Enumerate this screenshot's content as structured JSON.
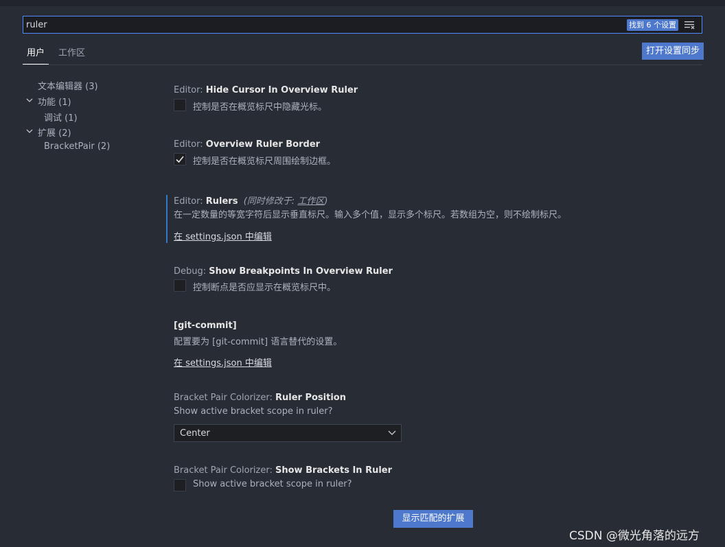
{
  "search": {
    "value": "ruler",
    "result_badge": "找到 6 个设置",
    "clear_icon": "clear-filter-icon"
  },
  "tabs": [
    {
      "label": "用户",
      "active": true
    },
    {
      "label": "工作区",
      "active": false
    }
  ],
  "sync_button": "打开设置同步",
  "toc": [
    {
      "label": "文本编辑器 (3)"
    },
    {
      "label": "功能 (1)",
      "expanded": true
    },
    {
      "label": "调试 (1)"
    },
    {
      "label": "扩展 (2)",
      "expanded": true
    },
    {
      "label": "BracketPair (2)"
    }
  ],
  "settings": [
    {
      "category": "Editor: ",
      "name": "Hide Cursor In Overview Ruler",
      "description": "控制是否在概览标尺中隐藏光标。",
      "checked": false
    },
    {
      "category": "Editor: ",
      "name": "Overview Ruler Border",
      "description": "控制是否在概览标尺周围绘制边框。",
      "checked": true
    },
    {
      "category": "Editor: ",
      "name": "Rulers",
      "note_prefix": "(同时修改于: ",
      "note_link": "工作区",
      "note_suffix": ")",
      "description": "在一定数量的等宽字符后显示垂直标尺。输入多个值，显示多个标尺。若数组为空，则不绘制标尺。",
      "edit_link": "在 settings.json 中编辑"
    },
    {
      "category": "Debug: ",
      "name": "Show Breakpoints In Overview Ruler",
      "description": "控制断点是否应显示在概览标尺中。",
      "checked": false
    },
    {
      "category": "",
      "name": "[git-commit]",
      "description": "配置要为 [git-commit] 语言替代的设置。",
      "edit_link": "在 settings.json 中编辑"
    },
    {
      "category": "Bracket Pair Colorizer: ",
      "name": "Ruler Position",
      "description": "Show active bracket scope in ruler?",
      "select_value": "Center"
    },
    {
      "category": "Bracket Pair Colorizer: ",
      "name": "Show Brackets In Ruler",
      "description": "Show active bracket scope in ruler?",
      "checked": false
    }
  ],
  "extensions_button": "显示匹配的扩展",
  "watermark": "CSDN @微光角落的远方",
  "colors": {
    "accent": "#4d78cc",
    "background": "#282c34",
    "focus_border": "#528bff",
    "modified_indicator": "#2f7bc7"
  }
}
